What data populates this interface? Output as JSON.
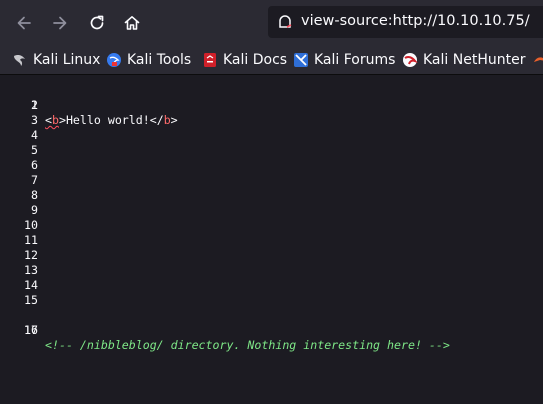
{
  "toolbar": {
    "url": "view-source:http://10.10.10.75/",
    "back_icon": "arrow-left-icon",
    "forward_icon": "arrow-right-icon",
    "reload_icon": "reload-icon",
    "home_icon": "home-icon"
  },
  "bookmarks": [
    {
      "label": "Kali Linux",
      "icon": "kali-dragon-icon"
    },
    {
      "label": "Kali Tools",
      "icon": "kali-tools-icon"
    },
    {
      "label": "Kali Docs",
      "icon": "kali-docs-icon"
    },
    {
      "label": "Kali Forums",
      "icon": "kali-forums-icon"
    },
    {
      "label": "Kali NetHunter",
      "icon": "kali-nethunter-icon"
    }
  ],
  "source": {
    "line1": {
      "open_lt": "<",
      "open_tag": "b",
      "open_gt": ">",
      "text": "Hello world!",
      "close_lt": "</",
      "close_tag": "b",
      "close_gt": ">"
    },
    "line16_comment": "<!-- /nibbleblog/ directory. Nothing interesting here! -->",
    "line_numbers": [
      "1",
      "2",
      "3",
      "4",
      "5",
      "6",
      "7",
      "8",
      "9",
      "10",
      "11",
      "12",
      "13",
      "14",
      "15",
      "16",
      "17"
    ]
  },
  "colors": {
    "chrome": "#2b2a33",
    "content": "#1c1b22",
    "comment": "#7ee787",
    "tagname": "#ff6b6b"
  }
}
